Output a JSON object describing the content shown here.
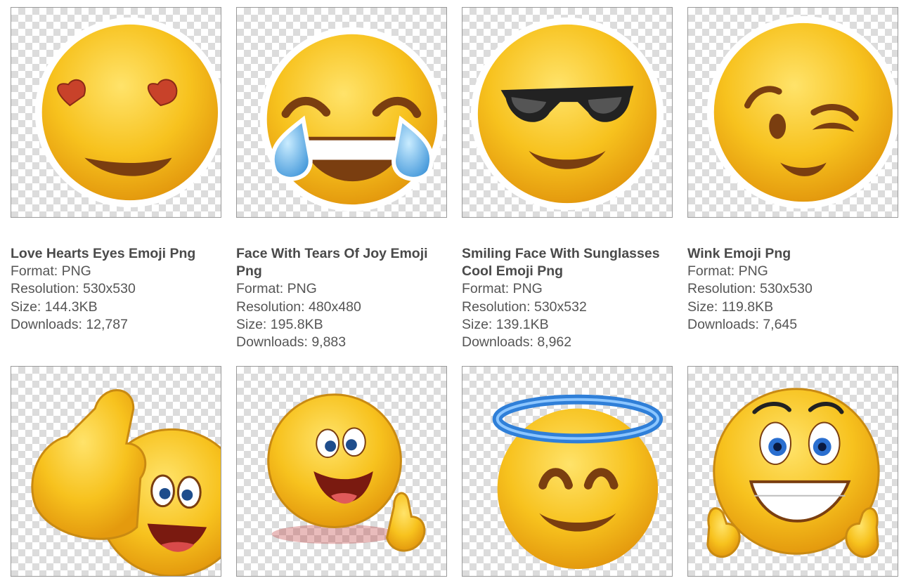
{
  "labels": {
    "format": "Format: ",
    "resolution": "Resolution: ",
    "size": "Size: ",
    "downloads": "Downloads: "
  },
  "items": [
    {
      "title": "Love Hearts Eyes Emoji Png",
      "format": "PNG",
      "resolution": "530x530",
      "size": "144.3KB",
      "downloads": "12,787",
      "icon": "heart-eyes-emoji-icon"
    },
    {
      "title": "Face With Tears Of Joy Emoji Png",
      "format": "PNG",
      "resolution": "480x480",
      "size": "195.8KB",
      "downloads": "9,883",
      "icon": "tears-of-joy-emoji-icon"
    },
    {
      "title": "Smiling Face With Sunglasses Cool Emoji Png",
      "format": "PNG",
      "resolution": "530x532",
      "size": "139.1KB",
      "downloads": "8,962",
      "icon": "sunglasses-emoji-icon"
    },
    {
      "title": "Wink Emoji Png",
      "format": "PNG",
      "resolution": "530x530",
      "size": "119.8KB",
      "downloads": "7,645",
      "icon": "wink-emoji-icon"
    },
    {
      "icon": "thumbs-up-emoji-icon"
    },
    {
      "icon": "happy-thumbs-up-emoji-icon"
    },
    {
      "icon": "halo-emoji-icon"
    },
    {
      "icon": "grinning-double-thumbs-up-emoji-icon"
    }
  ],
  "colors": {
    "face": "#f7c21e",
    "face_dark": "#e49a0e",
    "mouth": "#7a3e10",
    "heart": "#d2452a",
    "tear": "#5aaee8",
    "halo": "#2f7fd8",
    "text": "#555555",
    "title": "#4a4a4a",
    "border": "#9a9a9a"
  }
}
